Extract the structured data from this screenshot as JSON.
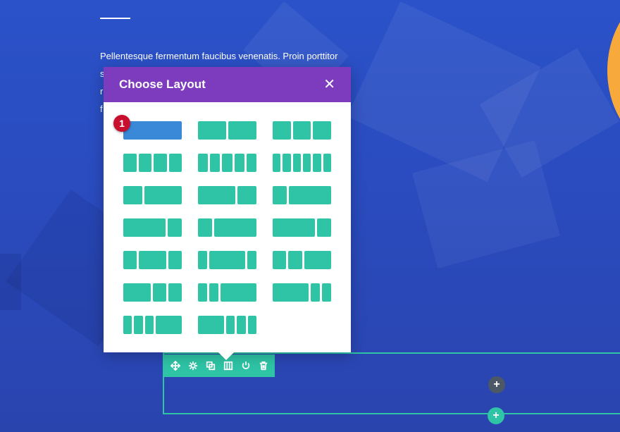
{
  "page": {
    "body_text": "Pellentesque fermentum faucibus venenatis. Proin porttitor",
    "body_fragments": [
      "s",
      "r",
      "f"
    ]
  },
  "modal": {
    "title": "Choose Layout",
    "close_glyph": "✕",
    "header_color": "#7d3bbd",
    "selected_color": "#3a88d8",
    "option_color": "#2ec4a5",
    "layouts": [
      [
        1
      ],
      [
        1,
        1
      ],
      [
        1,
        1,
        1
      ],
      [
        1,
        1,
        1,
        1
      ],
      [
        1,
        1,
        1,
        1,
        1
      ],
      [
        1,
        1,
        1,
        1,
        1,
        1
      ],
      [
        1,
        2
      ],
      [
        2,
        1
      ],
      [
        1,
        3
      ],
      [
        3,
        1
      ],
      [
        1,
        3
      ],
      [
        3,
        1
      ],
      [
        1,
        2,
        1
      ],
      [
        1,
        4,
        1
      ],
      [
        1,
        1,
        2
      ],
      [
        2,
        1,
        1
      ],
      [
        1,
        1,
        4
      ],
      [
        4,
        1,
        1
      ],
      [
        1,
        1,
        1,
        3
      ],
      [
        3,
        1,
        1,
        1
      ]
    ],
    "selected_index": 0
  },
  "badge": {
    "text": "1",
    "color": "#c8102e"
  },
  "toolbar": {
    "icons": [
      "move-icon",
      "gear-icon",
      "duplicate-icon",
      "columns-icon",
      "power-icon",
      "trash-icon"
    ]
  },
  "buttons": {
    "add_module": "+",
    "add_row": "+"
  }
}
